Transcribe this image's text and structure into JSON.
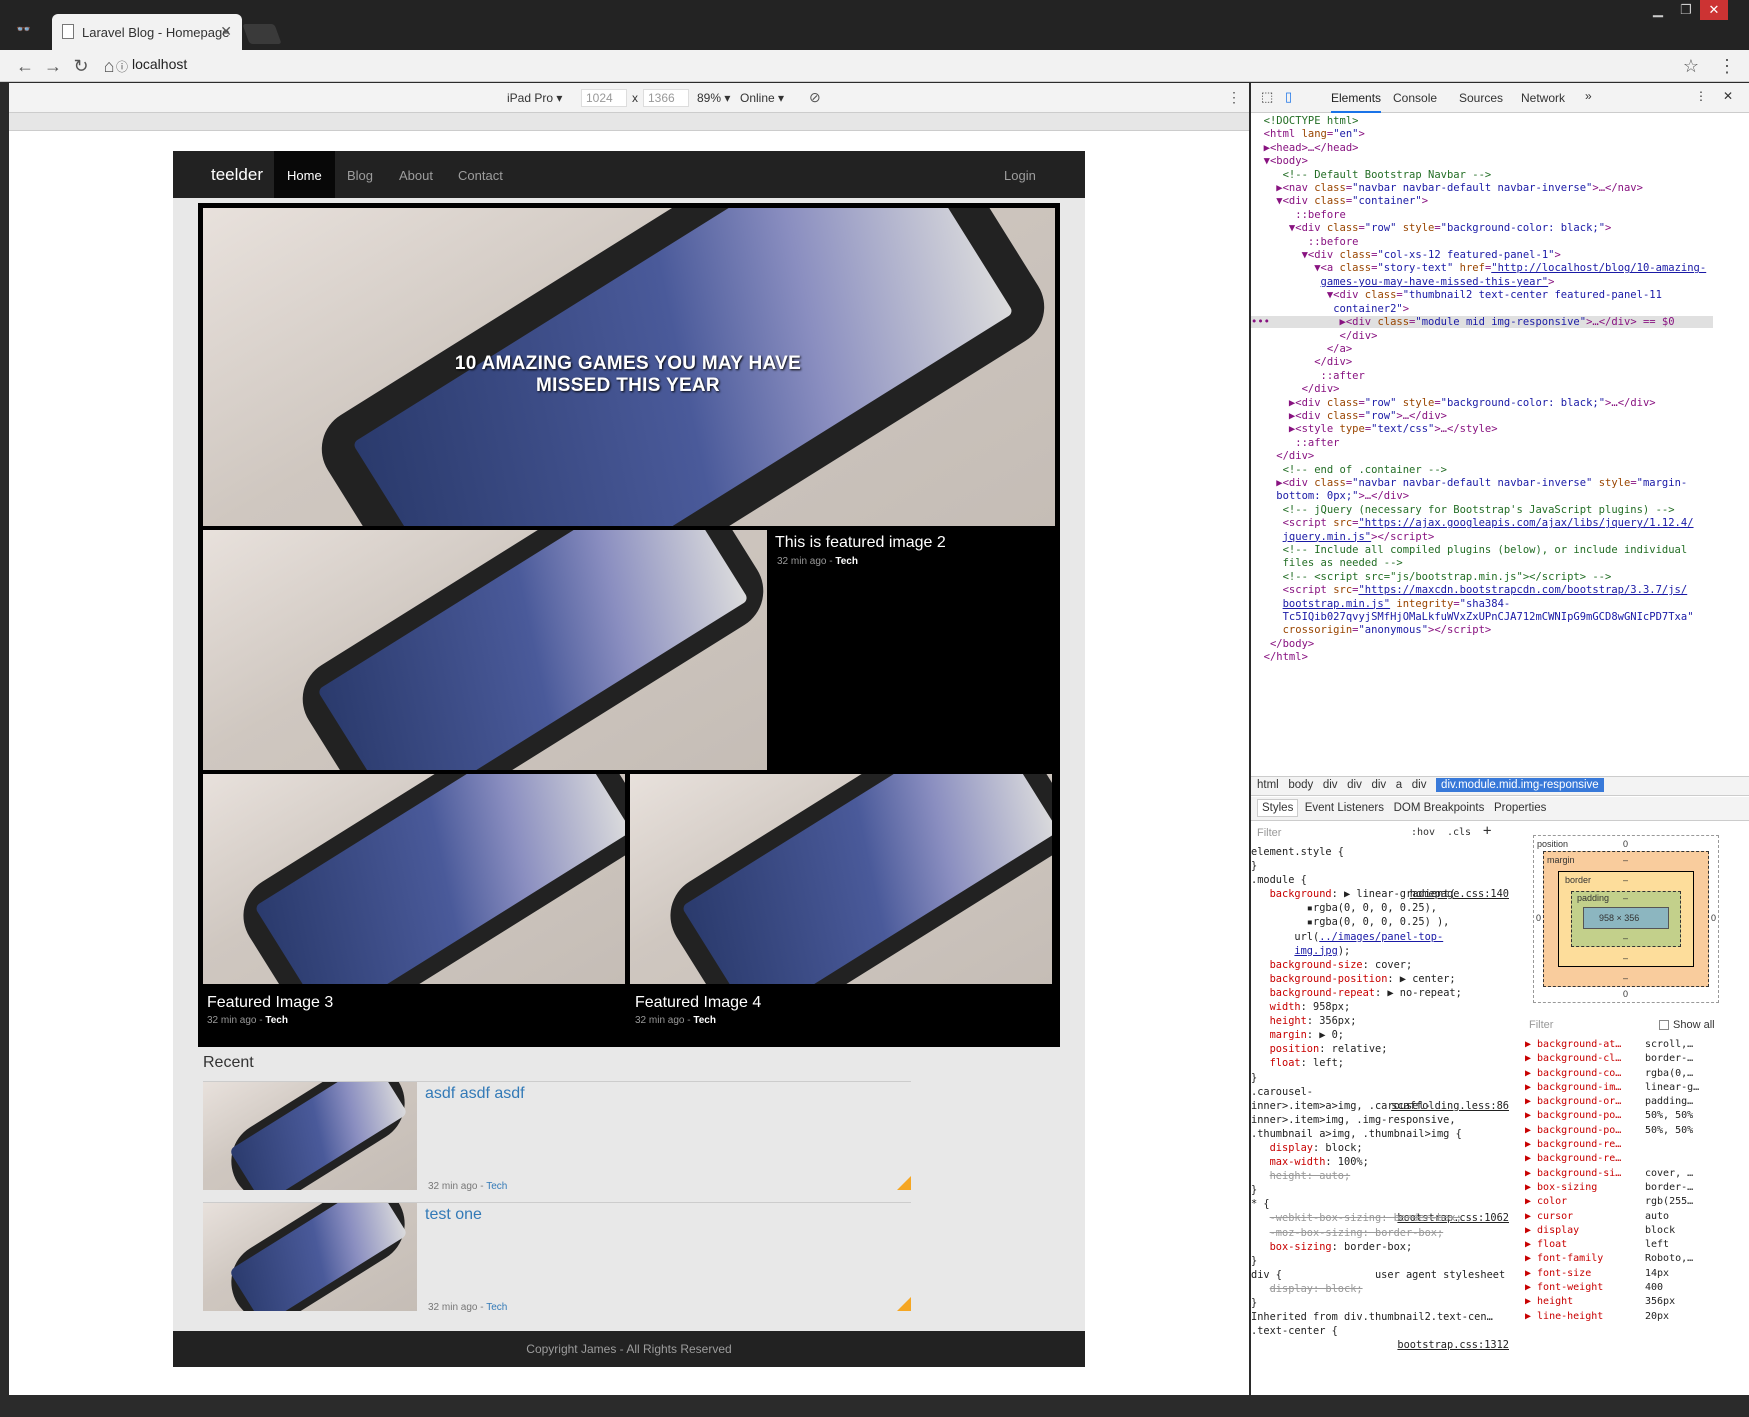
{
  "browser": {
    "tab_title": "Laravel Blog - Homepage",
    "url": "localhost"
  },
  "device": {
    "name": "iPad Pro ▾",
    "width": "1024",
    "x": "x",
    "height": "1366",
    "zoom": "89% ▾",
    "network": "Online ▾"
  },
  "site": {
    "brand": "teelder",
    "nav": [
      {
        "label": "Home"
      },
      {
        "label": "Blog"
      },
      {
        "label": "About"
      },
      {
        "label": "Contact"
      }
    ],
    "login": "Login",
    "feature1": {
      "title": "10 AMAZING GAMES YOU MAY HAVE MISSED THIS YEAR"
    },
    "feature2": {
      "title": "This is featured image 2",
      "time": "32 min ago - ",
      "cat": "Tech"
    },
    "feature3": {
      "title": "Featured Image 3",
      "time": "32 min ago - ",
      "cat": "Tech"
    },
    "feature4": {
      "title": "Featured Image 4",
      "time": "32 min ago - ",
      "cat": "Tech"
    },
    "recent_heading": "Recent",
    "posts": [
      {
        "title": "asdf asdf asdf",
        "time": "32 min ago - ",
        "cat": "Tech"
      },
      {
        "title": "test one",
        "time": "32 min ago - ",
        "cat": "Tech"
      }
    ],
    "footer": "Copyright James - All Rights Reserved"
  },
  "devtools": {
    "tabs": [
      "Elements",
      "Console",
      "Sources",
      "Network"
    ],
    "breadcrumbs": [
      "html",
      "body",
      "div",
      "div",
      "div",
      "a",
      "div"
    ],
    "breadcrumb_selected": "div.module.mid.img-responsive",
    "style_tabs": [
      "Styles",
      "Event Listeners",
      "DOM Breakpoints",
      "Properties"
    ],
    "filter_placeholder": "Filter",
    "hov": ":hov",
    "cls": ".cls",
    "box": {
      "position": "position",
      "margin": "margin",
      "border": "border",
      "padding": "padding",
      "content": "958 × 356",
      "pos_top": "0",
      "pos_bottom": "0",
      "pos_left": "0",
      "pos_right": "0",
      "dash": "–"
    },
    "computed_filter": "Filter",
    "show_all": "Show all",
    "computed": [
      [
        "background-at…",
        "scroll,…"
      ],
      [
        "background-cl…",
        "border-…"
      ],
      [
        "background-co…",
        "rgba(0,…"
      ],
      [
        "background-im…",
        "linear-g…"
      ],
      [
        "background-or…",
        "padding…"
      ],
      [
        "background-po…",
        "50%, 50%"
      ],
      [
        "background-po…",
        "50%, 50%"
      ],
      [
        "background-re…",
        ""
      ],
      [
        "background-re…",
        ""
      ],
      [
        "background-si…",
        "cover, …"
      ],
      [
        "box-sizing",
        "border-…"
      ],
      [
        "color",
        "rgb(255…"
      ],
      [
        "cursor",
        "auto"
      ],
      [
        "display",
        "block"
      ],
      [
        "float",
        "left"
      ],
      [
        "font-family",
        "Roboto,…"
      ],
      [
        "font-size",
        "14px"
      ],
      [
        "font-weight",
        "400"
      ],
      [
        "height",
        "356px"
      ],
      [
        "line-height",
        "20px"
      ]
    ]
  }
}
